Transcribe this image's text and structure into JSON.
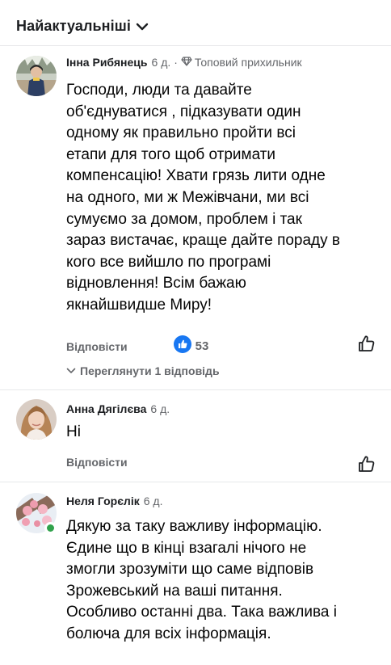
{
  "sort": {
    "label": "Найактуальніші"
  },
  "comments": [
    {
      "author": "Інна Рибянець",
      "time": "6 д.",
      "sep": "·",
      "badge": "Топовий прихильник",
      "lines": [
        "Господи, люди та давайте",
        "об'єднуватися , підказувати один",
        "одному як правильно пройти всі",
        "етапи для того щоб отримати",
        "компенсацію! Хвати грязь лити одне",
        "на одного, ми ж Межівчани, ми всі",
        "сумуємо за домом, проблем і так",
        "зараз вистачає, краще дайте пораду в",
        "кого все вийшло по програмі",
        "відновлення! Всім бажаю",
        "якнайшвидше Миру!"
      ],
      "reply_label": "Відповісти",
      "reaction_count": "53",
      "view_replies": "Переглянути 1 відповідь"
    },
    {
      "author": "Анна Дягілєва",
      "time": "6 д.",
      "lines": [
        "Ні"
      ],
      "reply_label": "Відповісти"
    },
    {
      "author": "Неля Горєлік",
      "time": "6 д.",
      "lines": [
        "Дякую за таку важливу інформацію.",
        "Єдине що в кінці взагалі нічого не",
        "змогли зрозуміти що саме відповів",
        "Зрожевський на ваші питання.",
        "Особливо останні два. Така важлива і",
        "болюча для всіх інформація."
      ]
    }
  ],
  "colors": {
    "text": "#050505",
    "secondary": "#65676b",
    "like_blue": "#1877f2",
    "online_green": "#31a24c"
  }
}
